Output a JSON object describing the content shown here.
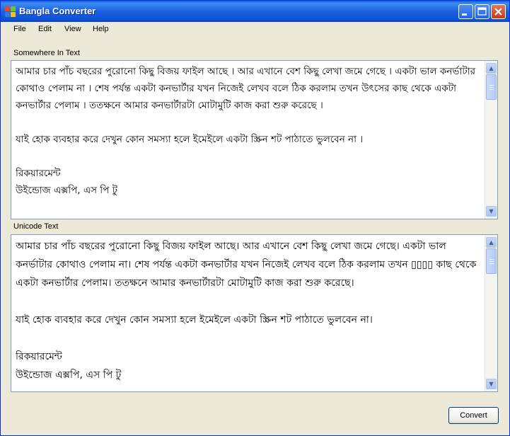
{
  "window": {
    "title": "Bangla Converter"
  },
  "menu": {
    "items": [
      "File",
      "Edit",
      "View",
      "Help"
    ]
  },
  "source": {
    "label": "Somewhere In Text",
    "text": "আমার চার পাঁচ বছরের পুরোনো কিছু বিজয় ফাইল আছে । আর এখানে বেশ কিছু লেখা জমে গেছে । একটা ভাল কনর্ভাটার কোথাও পেলাম না । শেষ পর্যন্ত একটা কনভার্টার যখন নিজেই লেখব বলে ঠিক করলাম তখন উৎসের কাছ থেকে একটা কনভার্টার পেলাম । ততক্ষনে আমার কনভার্টারটা মোটামুটি কাজ করা শুরু করেছে ।\n\nযাই হোক ব্যবহার করে দেখুন কোন সমস্যা হলে ইমেইলে একটা স্ক্রিন শট পাঠাতে ভুলবেন না ।\n\nরিকয়ারমেন্ট\nউইন্ডোজ এক্সপি, এস পি টু"
  },
  "output": {
    "label": "Unicode Text",
    "text": "আমার চার পাঁচ বছরের পুরোনো কিছু বিজয় ফাইল আছে। আর এখানে বেশ কিছু লেখা জমে গেছে। একটা ভাল কনর্ভাটার কোথাও পেলাম না। শেষ পর্যন্ত একটা কনভার্টার যখন নিজেই লেখব বলে ঠিক করলাম তখন ▯▯▯▯ কাছ থেকে একটা কনভার্টার পেলাম। ততক্ষনে আমার কনভার্টারটা মোটামুটি কাজ করা শুরু করেছে।\n\nযাই হোক ব্যবহার করে দেখুন কোন সমস্যা হলে ইমেইলে একটা স্ক্রিন শট পাঠাতে ভুলবেন না।\n\nরিকয়ারমেন্ট\nউইন্ডোজ এক্সপি, এস পি টু"
  },
  "buttons": {
    "convert": "Convert"
  },
  "icons": {
    "minimize": "minimize-icon",
    "maximize": "maximize-icon",
    "close": "close-icon"
  }
}
